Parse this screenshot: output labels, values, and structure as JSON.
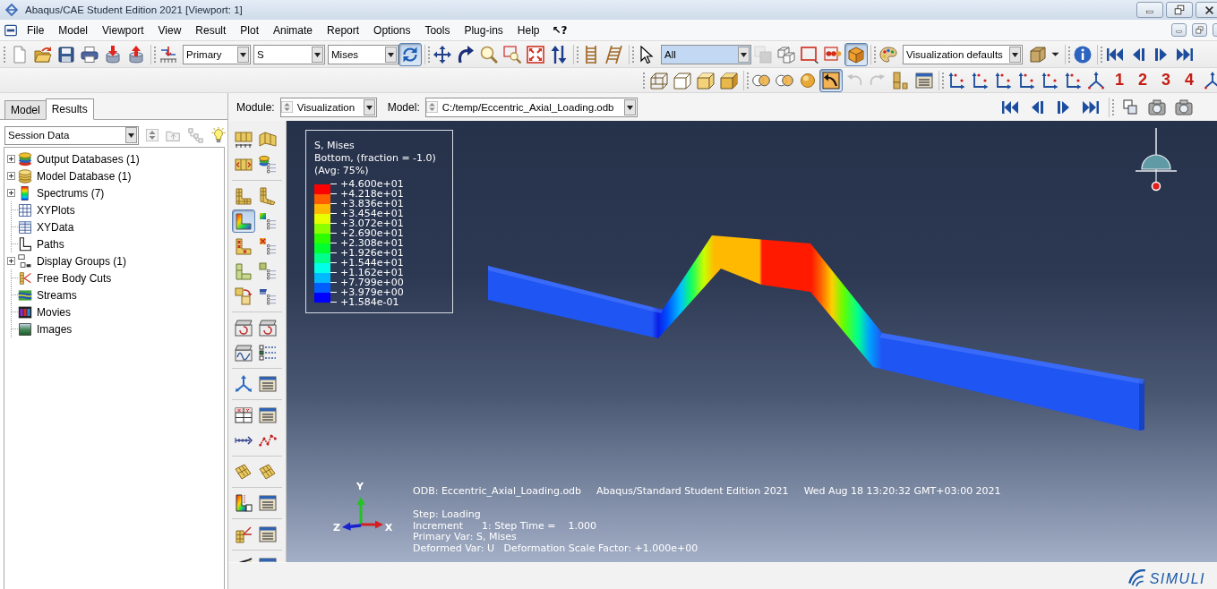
{
  "window": {
    "title": "Abaqus/CAE Student Edition 2021 [Viewport: 1]"
  },
  "menu_bar": {
    "items": [
      "File",
      "Model",
      "Viewport",
      "View",
      "Result",
      "Plot",
      "Animate",
      "Report",
      "Options",
      "Tools",
      "Plug-ins",
      "Help"
    ],
    "whats_this": "↖?"
  },
  "toolbar_1": [
    {
      "kind": "button",
      "pressed": false,
      "disabled": false
    },
    {
      "kind": "button",
      "pressed": false,
      "disabled": false
    },
    {
      "kind": "button",
      "pressed": false,
      "disabled": false
    },
    {
      "kind": "button",
      "pressed": false,
      "disabled": false
    },
    {
      "kind": "button",
      "pressed": false,
      "disabled": false
    },
    {
      "kind": "button",
      "pressed": false,
      "disabled": false
    },
    {
      "kind": "separator"
    },
    {
      "kind": "button",
      "pressed": false,
      "disabled": false
    },
    {
      "kind": "combo",
      "value": "Primary",
      "highlighted": false
    },
    {
      "kind": "combo",
      "value": "S",
      "highlighted": false
    },
    {
      "kind": "combo",
      "value": "Mises",
      "highlighted": false
    },
    {
      "kind": "button",
      "pressed": true,
      "disabled": false
    },
    {
      "kind": "separator"
    },
    {
      "kind": "button",
      "pressed": false,
      "disabled": false
    },
    {
      "kind": "button",
      "pressed": false,
      "disabled": false
    },
    {
      "kind": "button",
      "pressed": false,
      "disabled": false
    },
    {
      "kind": "button",
      "pressed": false,
      "disabled": false
    },
    {
      "kind": "button",
      "pressed": false,
      "disabled": false
    },
    {
      "kind": "button",
      "pressed": false,
      "disabled": false
    },
    {
      "kind": "separator"
    },
    {
      "kind": "button",
      "pressed": false,
      "disabled": false
    },
    {
      "kind": "button",
      "pressed": false,
      "disabled": false
    },
    {
      "kind": "separator"
    },
    {
      "kind": "button",
      "pressed": false,
      "disabled": false
    },
    {
      "kind": "combo",
      "value": "All",
      "highlighted": true
    },
    {
      "kind": "button",
      "pressed": false,
      "disabled": true
    },
    {
      "kind": "button",
      "pressed": false,
      "disabled": false
    },
    {
      "kind": "button",
      "pressed": false,
      "disabled": false
    },
    {
      "kind": "button",
      "pressed": false,
      "disabled": false
    },
    {
      "kind": "button",
      "pressed": true,
      "disabled": false
    },
    {
      "kind": "separator"
    },
    {
      "kind": "button",
      "pressed": false,
      "disabled": false
    },
    {
      "kind": "combo",
      "value": "Visualization defaults",
      "highlighted": false
    },
    {
      "kind": "menu_button",
      "pressed": false,
      "disabled": false
    },
    {
      "kind": "separator"
    },
    {
      "kind": "button",
      "pressed": false,
      "disabled": false
    },
    {
      "kind": "separator"
    },
    {
      "kind": "button",
      "pressed": false,
      "disabled": false
    },
    {
      "kind": "button",
      "pressed": false,
      "disabled": false
    },
    {
      "kind": "button",
      "pressed": false,
      "disabled": false
    },
    {
      "kind": "button",
      "pressed": false,
      "disabled": false
    }
  ],
  "toolbar_2": [
    {
      "kind": "button",
      "pressed": false,
      "disabled": false
    },
    {
      "kind": "button",
      "pressed": false,
      "disabled": false
    },
    {
      "kind": "button",
      "pressed": false,
      "disabled": false
    },
    {
      "kind": "button",
      "pressed": false,
      "disabled": false
    },
    {
      "kind": "separator"
    },
    {
      "kind": "button",
      "pressed": false,
      "disabled": false
    },
    {
      "kind": "button",
      "pressed": false,
      "disabled": false
    },
    {
      "kind": "button",
      "pressed": false,
      "disabled": false
    },
    {
      "kind": "button",
      "pressed": true,
      "disabled": false
    },
    {
      "kind": "button",
      "pressed": false,
      "disabled": true
    },
    {
      "kind": "button",
      "pressed": false,
      "disabled": true
    },
    {
      "kind": "button",
      "pressed": false,
      "disabled": false
    },
    {
      "kind": "button",
      "pressed": false,
      "disabled": false
    },
    {
      "kind": "separator"
    },
    {
      "kind": "button",
      "pressed": false,
      "disabled": false
    },
    {
      "kind": "button",
      "pressed": false,
      "disabled": false
    },
    {
      "kind": "button",
      "pressed": false,
      "disabled": false
    },
    {
      "kind": "button",
      "pressed": false,
      "disabled": false
    },
    {
      "kind": "button",
      "pressed": false,
      "disabled": false
    },
    {
      "kind": "button",
      "pressed": false,
      "disabled": false
    },
    {
      "kind": "button",
      "pressed": false,
      "disabled": false
    },
    {
      "kind": "label",
      "label": "1"
    },
    {
      "kind": "label",
      "label": "2"
    },
    {
      "kind": "label",
      "label": "3"
    },
    {
      "kind": "label",
      "label": "4"
    },
    {
      "kind": "button",
      "pressed": false,
      "disabled": false
    }
  ],
  "model_tree": {
    "tabs": [
      {
        "label": "Model",
        "selected": false
      },
      {
        "label": "Results",
        "selected": true
      }
    ],
    "filter": "Session Data",
    "items": [
      {
        "label": "Output Databases (1)",
        "expandable": true,
        "expanded": false
      },
      {
        "label": "Model Database (1)",
        "expandable": true,
        "expanded": false
      },
      {
        "label": "Spectrums (7)",
        "expandable": true,
        "expanded": false
      },
      {
        "label": "XYPlots",
        "expandable": false
      },
      {
        "label": "XYData",
        "expandable": false
      },
      {
        "label": "Paths",
        "expandable": false
      },
      {
        "label": "Display Groups (1)",
        "expandable": true,
        "expanded": false
      },
      {
        "label": "Free Body Cuts",
        "expandable": false
      },
      {
        "label": "Streams",
        "expandable": false
      },
      {
        "label": "Movies",
        "expandable": false
      },
      {
        "label": "Images",
        "expandable": false
      }
    ]
  },
  "module_bar": {
    "module_label": "Module:",
    "module": "Visualization",
    "model_label": "Model:",
    "model": "C:/temp/Eccentric_Axial_Loading.odb",
    "tools": [
      {
        "kind": "button",
        "pressed": false,
        "disabled": false
      },
      {
        "kind": "button",
        "pressed": false,
        "disabled": false
      },
      {
        "kind": "button",
        "pressed": false,
        "disabled": false
      },
      {
        "kind": "button",
        "pressed": false,
        "disabled": false
      },
      {
        "kind": "separator"
      },
      {
        "kind": "button",
        "pressed": false,
        "disabled": false
      },
      {
        "kind": "button",
        "pressed": false,
        "disabled": false
      },
      {
        "kind": "button",
        "pressed": false,
        "disabled": false
      }
    ]
  },
  "toolbox": [
    [
      {
        "pressed": false
      },
      {
        "pressed": false
      },
      {
        "pressed": false
      },
      {
        "pressed": false
      }
    ],
    [
      {
        "pressed": false
      },
      {
        "pressed": false
      },
      {
        "pressed": true
      },
      {
        "pressed": false
      },
      {
        "pressed": false
      },
      {
        "pressed": false
      },
      {
        "pressed": false
      },
      {
        "pressed": false
      },
      {
        "pressed": false
      },
      {
        "pressed": false
      }
    ],
    [
      {
        "pressed": false
      },
      {
        "pressed": false
      },
      {
        "pressed": false
      },
      {
        "pressed": false
      }
    ],
    [
      {
        "pressed": false
      },
      {
        "pressed": false
      }
    ],
    [
      {
        "pressed": false
      },
      {
        "pressed": false
      },
      {
        "pressed": false
      },
      {
        "pressed": false
      }
    ],
    [
      {
        "pressed": false
      },
      {
        "pressed": false
      }
    ],
    [
      {
        "pressed": false
      },
      {
        "pressed": false
      }
    ],
    [
      {
        "pressed": false
      },
      {
        "pressed": false
      }
    ],
    [
      {
        "pressed": false
      },
      {
        "pressed": false
      }
    ]
  ],
  "viewport": {
    "legend": {
      "title_lines": [
        "S, Mises",
        "Bottom, (fraction = -1.0)",
        "(Avg: 75%)"
      ],
      "bands": [
        {
          "color": "#ff0000"
        },
        {
          "color": "#ff5d00"
        },
        {
          "color": "#ffb900"
        },
        {
          "color": "#e8ff00"
        },
        {
          "color": "#8bff00"
        },
        {
          "color": "#2eff00"
        },
        {
          "color": "#00ff2e"
        },
        {
          "color": "#00ff8b"
        },
        {
          "color": "#00ffe8"
        },
        {
          "color": "#00b9ff"
        },
        {
          "color": "#005dff"
        },
        {
          "color": "#0000ff"
        }
      ],
      "values": [
        "+4.600e+01",
        "+4.218e+01",
        "+3.836e+01",
        "+3.454e+01",
        "+3.072e+01",
        "+2.690e+01",
        "+2.308e+01",
        "+1.926e+01",
        "+1.544e+01",
        "+1.162e+01",
        "+7.799e+00",
        "+3.979e+00",
        "+1.584e-01"
      ]
    },
    "info": {
      "header": [
        "ODB: Eccentric_Axial_Loading.odb",
        "Abaqus/Standard Student Edition 2021",
        "Wed Aug 18 13:20:32 GMT+03:00 2021"
      ],
      "lines": [
        "Step: Loading",
        "Increment      1: Step Time =    1.000",
        "Primary Var: S, Mises",
        "Deformed Var: U   Deformation Scale Factor: +1.000e+00"
      ]
    },
    "triad": {
      "y": "Y",
      "z": "Z",
      "x": "X"
    }
  },
  "status_bar": {
    "brand": "SIMULI"
  }
}
